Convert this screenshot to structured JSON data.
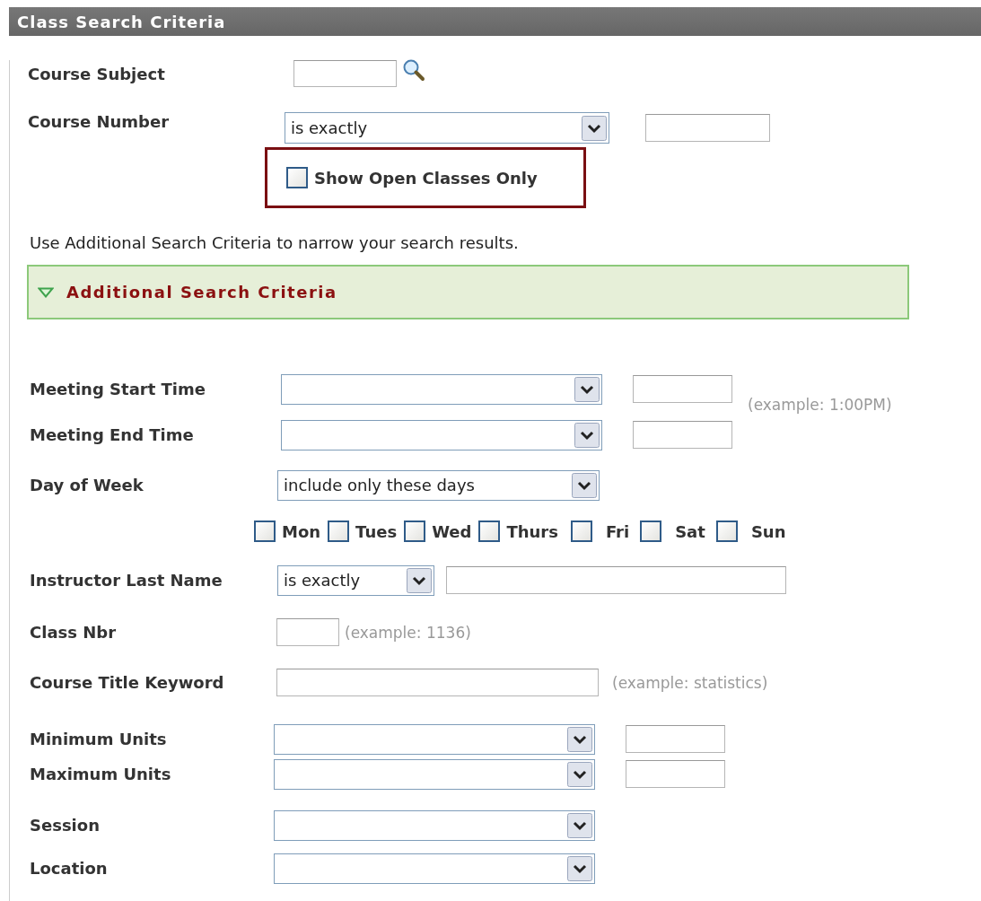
{
  "header": {
    "title": "Class Search Criteria"
  },
  "basic": [
    {
      "kind": "lookup",
      "label": "Course Subject"
    },
    {
      "kind": "select_input",
      "label": "Course Number",
      "value": "is exactly"
    }
  ],
  "open_only": {
    "label": "Show Open Classes Only",
    "checked": false
  },
  "hint": "Use Additional Search Criteria to narrow your search results.",
  "additional": {
    "title": "Additional Search Criteria",
    "expanded": true
  },
  "rows": [
    {
      "kind": "select_input",
      "label": "Meeting Start Time",
      "note": "(example: 1:00PM)"
    },
    {
      "kind": "select_input",
      "label": "Meeting End Time"
    },
    {
      "kind": "select",
      "label": "Day of Week",
      "value": "include only these days"
    },
    {
      "kind": "days",
      "days": [
        {
          "label": "Mon",
          "checked": false
        },
        {
          "label": "Tues",
          "checked": false
        },
        {
          "label": "Wed",
          "checked": false
        },
        {
          "label": "Thurs",
          "checked": false
        },
        {
          "label": "Fri",
          "checked": false
        },
        {
          "label": "Sat",
          "checked": false
        },
        {
          "label": "Sun",
          "checked": false
        }
      ]
    },
    {
      "kind": "select_input",
      "label": "Instructor Last Name",
      "value": "is exactly"
    },
    {
      "kind": "input",
      "label": "Class Nbr",
      "note": "(example: 1136)"
    },
    {
      "kind": "input",
      "label": "Course Title Keyword",
      "note": "(example: statistics)"
    },
    {
      "kind": "select_input",
      "label": "Minimum Units"
    },
    {
      "kind": "select_input",
      "label": "Maximum Units"
    },
    {
      "kind": "select",
      "label": "Session"
    },
    {
      "kind": "select",
      "label": "Location"
    }
  ]
}
